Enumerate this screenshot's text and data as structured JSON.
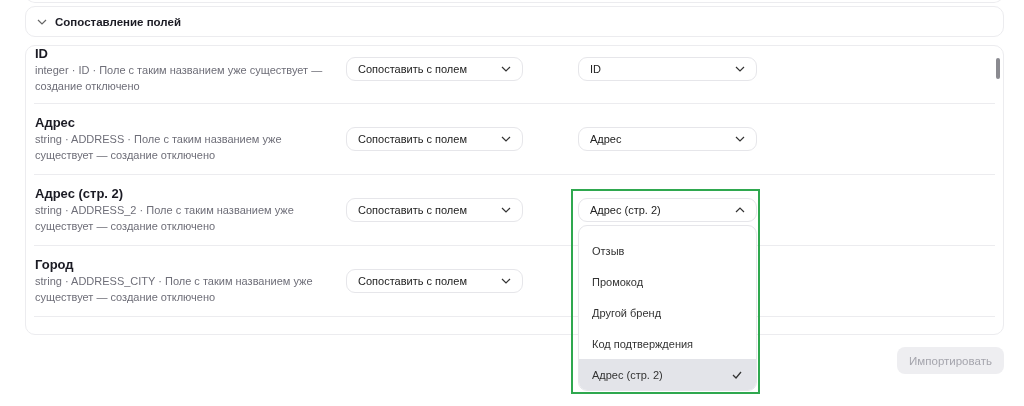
{
  "section": {
    "title": "Сопоставление полей",
    "expanded": true
  },
  "fields": [
    {
      "name": "ID",
      "description": "integer · ID · Поле с таким названием уже существует — создание отключено",
      "action": "Сопоставить с полем",
      "target": "ID",
      "open": false
    },
    {
      "name": "Адрес",
      "description": "string · ADDRESS · Поле с таким названием уже существует — создание отключено",
      "action": "Сопоставить с полем",
      "target": "Адрес",
      "open": false
    },
    {
      "name": "Адрес (стр. 2)",
      "description": "string · ADDRESS_2 · Поле с таким названием уже существует — создание отключено",
      "action": "Сопоставить с полем",
      "target": "Адрес (стр. 2)",
      "open": true
    },
    {
      "name": "Город",
      "description": "string · ADDRESS_CITY · Поле с таким названием уже существует — создание отключено",
      "action": "Сопоставить с полем"
    }
  ],
  "dropdown": {
    "options": [
      {
        "label": "Отзыв",
        "selected": false
      },
      {
        "label": "Промокод",
        "selected": false
      },
      {
        "label": "Другой бренд",
        "selected": false
      },
      {
        "label": "Код подтверждения",
        "selected": false
      },
      {
        "label": "Адрес (стр. 2)",
        "selected": true
      }
    ]
  },
  "import_button": {
    "label": "Импортировать",
    "disabled": true
  }
}
